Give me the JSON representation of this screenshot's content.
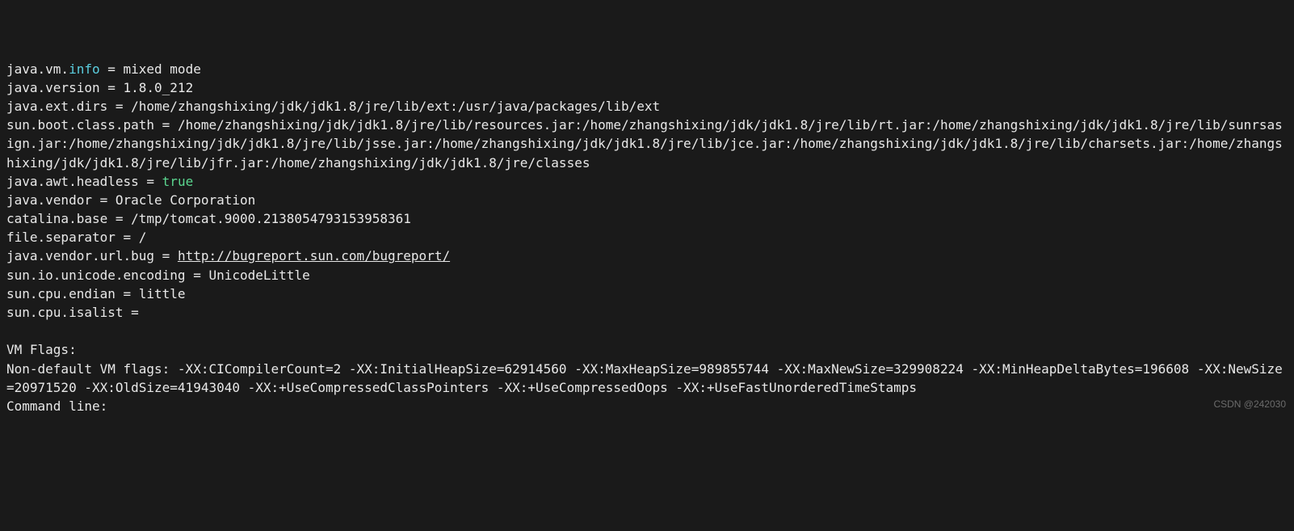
{
  "props": {
    "java_vm_info": {
      "key_prefix": "java.vm.",
      "key_highlight": "info",
      "sep": " = ",
      "value": "mixed mode"
    },
    "java_version": {
      "key": "java.version",
      "sep": " = ",
      "value": "1.8.0_212"
    },
    "java_ext_dirs": {
      "key": "java.ext.dirs",
      "sep": " = ",
      "value": "/home/zhangshixing/jdk/jdk1.8/jre/lib/ext:/usr/java/packages/lib/ext"
    },
    "sun_boot_class_path": {
      "key": "sun.boot.class.path",
      "sep": " = ",
      "value": "/home/zhangshixing/jdk/jdk1.8/jre/lib/resources.jar:/home/zhangshixing/jdk/jdk1.8/jre/lib/rt.jar:/home/zhangshixing/jdk/jdk1.8/jre/lib/sunrsasign.jar:/home/zhangshixing/jdk/jdk1.8/jre/lib/jsse.jar:/home/zhangshixing/jdk/jdk1.8/jre/lib/jce.jar:/home/zhangshixing/jdk/jdk1.8/jre/lib/charsets.jar:/home/zhangshixing/jdk/jdk1.8/jre/lib/jfr.jar:/home/zhangshixing/jdk/jdk1.8/jre/classes"
    },
    "java_awt_headless": {
      "key": "java.awt.headless",
      "sep": " = ",
      "value_highlight": "true"
    },
    "java_vendor": {
      "key": "java.vendor",
      "sep": " = ",
      "value": "Oracle Corporation"
    },
    "catalina_base": {
      "key": "catalina.base",
      "sep": " = ",
      "value": "/tmp/tomcat.9000.2138054793153958361"
    },
    "file_separator": {
      "key": "file.separator",
      "sep": " = ",
      "value": "/"
    },
    "java_vendor_url_bug": {
      "key": "java.vendor.url.bug",
      "sep": " = ",
      "url": "http://bugreport.sun.com/bugreport/"
    },
    "sun_io_unicode_encoding": {
      "key": "sun.io.unicode.encoding",
      "sep": " = ",
      "value": "UnicodeLittle"
    },
    "sun_cpu_endian": {
      "key": "sun.cpu.endian",
      "sep": " = ",
      "value": "little"
    },
    "sun_cpu_isalist": {
      "key": "sun.cpu.isalist",
      "sep": " =",
      "value": ""
    }
  },
  "vm_flags": {
    "heading": "VM Flags:",
    "non_default_label": "Non-default VM flags: ",
    "non_default_value": "-XX:CICompilerCount=2 -XX:InitialHeapSize=62914560 -XX:MaxHeapSize=989855744 -XX:MaxNewSize=329908224 -XX:MinHeapDeltaBytes=196608 -XX:NewSize=20971520 -XX:OldSize=41943040 -XX:+UseCompressedClassPointers -XX:+UseCompressedOops -XX:+UseFastUnorderedTimeStamps",
    "command_line_label": "Command line:",
    "command_line_value": ""
  },
  "watermark": "CSDN @242030"
}
